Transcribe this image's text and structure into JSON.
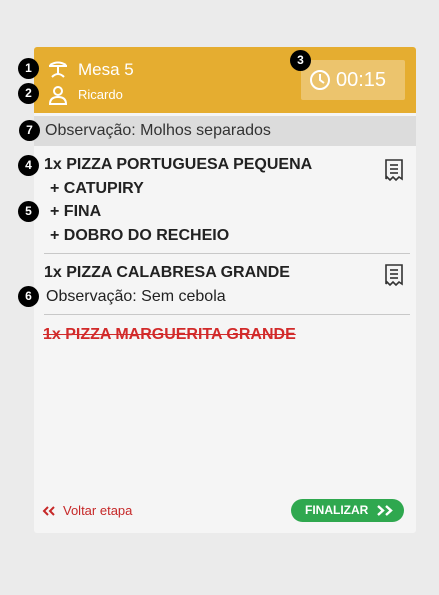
{
  "header": {
    "table_label": "Mesa 5",
    "waiter_name": "Ricardo",
    "timer": "00:15",
    "icons": {
      "table": "restaurant-table-icon",
      "waiter": "user-icon",
      "timer": "clock-icon"
    },
    "colors": {
      "background": "#e5ad30",
      "timer_background": "#ecc46d"
    }
  },
  "order_observation": "Observação: Molhos separados",
  "items": [
    {
      "title": "1x PIZZA PORTUGUESA PEQUENA",
      "addons": [
        "+ CATUPIRY",
        "+ FINA",
        "+ DOBRO DO RECHEIO"
      ],
      "icon": "receipt-icon"
    },
    {
      "title": "1x PIZZA CALABRESA GRANDE",
      "note": "Observação: Sem cebola",
      "icon": "receipt-icon"
    },
    {
      "title": "1x PIZZA MARGUERITA GRANDE",
      "status": "cancelled"
    }
  ],
  "footer": {
    "back_label": "Voltar etapa",
    "finish_label": "FINALIZAR"
  },
  "badges": [
    "1",
    "2",
    "3",
    "4",
    "5",
    "6",
    "7"
  ],
  "colors": {
    "accent": "#e5ad30",
    "cancelled": "#d22a2a",
    "back_link": "#c62828",
    "finish_button": "#2fa84f"
  }
}
